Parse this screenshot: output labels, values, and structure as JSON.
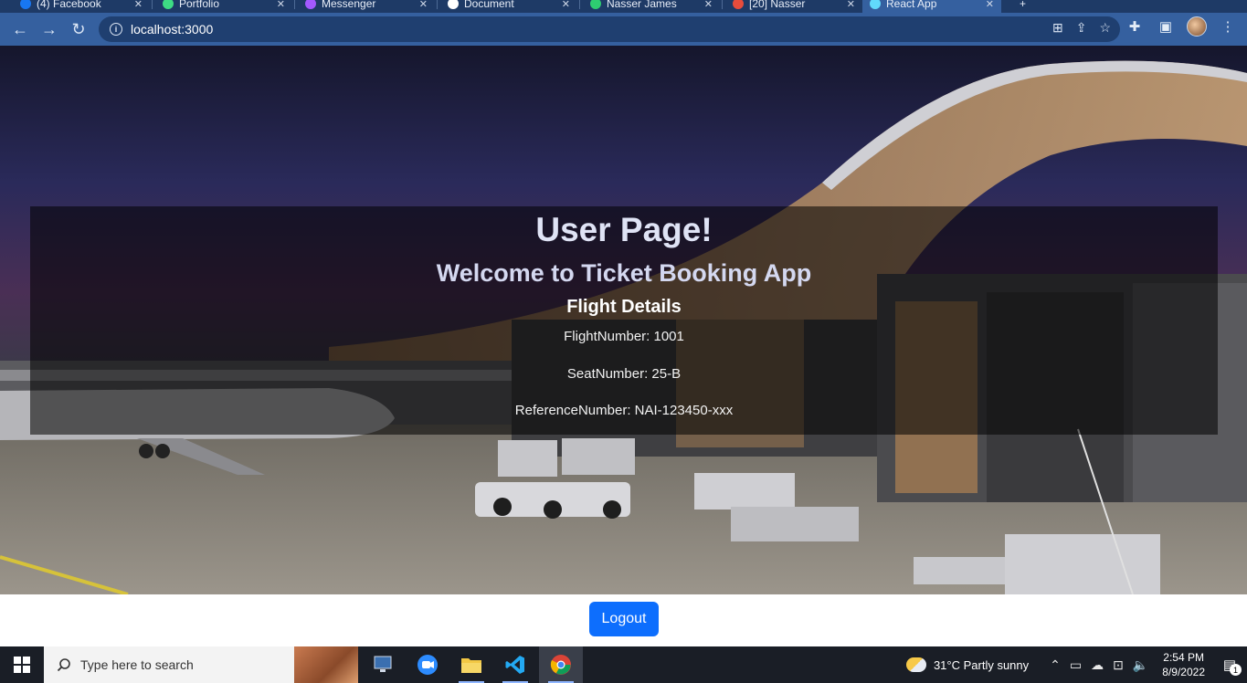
{
  "browser": {
    "tabs": [
      {
        "label": "(4) Facebook",
        "color": "#1877f2"
      },
      {
        "label": "Portfolio",
        "color": "#3ddc84"
      },
      {
        "label": "Messenger",
        "color": "#a259ff"
      },
      {
        "label": "Document",
        "color": "#ffffff"
      },
      {
        "label": "Nasser James",
        "color": "#2ecc71"
      },
      {
        "label": "[20] Nasser",
        "color": "#e74c3c"
      },
      {
        "label": "React App",
        "color": "#61dafb"
      }
    ],
    "url": "localhost:3000"
  },
  "page": {
    "title": "User Page!",
    "welcome": "Welcome to Ticket Booking App",
    "details_heading": "Flight Details",
    "flight_number": "FlightNumber: 1001",
    "seat_number": "SeatNumber: 25-B",
    "reference_number": "ReferenceNumber: NAI-123450-xxx",
    "logout_label": "Logout"
  },
  "taskbar": {
    "search_placeholder": "Type here to search",
    "weather": "31°C  Partly sunny",
    "time": "2:54 PM",
    "date": "8/9/2022",
    "notifications": "1"
  }
}
